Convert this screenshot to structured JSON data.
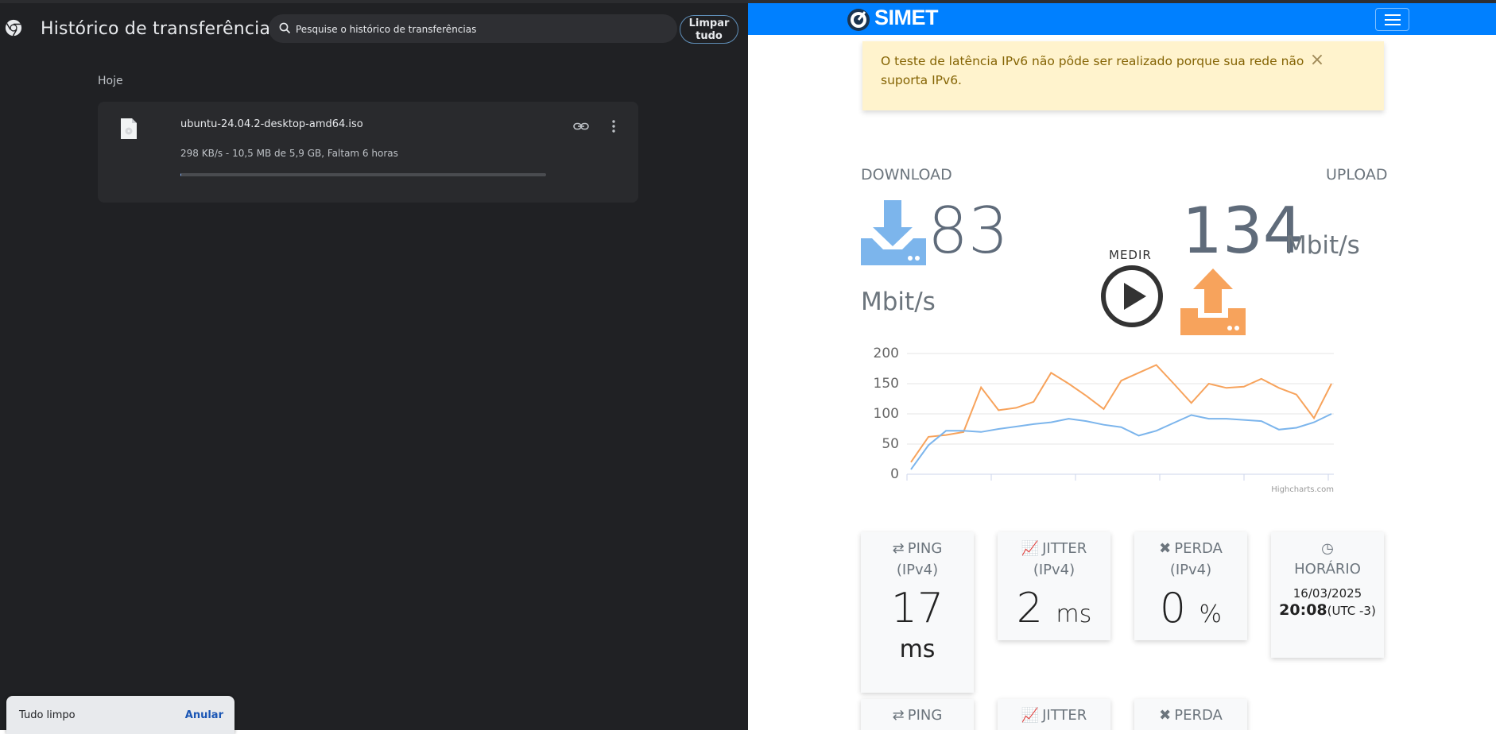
{
  "downloads": {
    "title": "Histórico de transferências",
    "search_placeholder": "Pesquise o histórico de transferências",
    "clear_all_label": "Limpar tudo",
    "section_label": "Hoje",
    "items": [
      {
        "filename": "ubuntu-24.04.2-desktop-amd64.iso",
        "status": "298 KB/s - 10,5 MB de 5,9 GB, Faltam 6 horas",
        "progress": 0.002
      }
    ],
    "toast": {
      "message": "Tudo limpo",
      "undo_label": "Anular"
    }
  },
  "simet": {
    "brand": "SIMET",
    "alert_text": "O teste de latência IPv6 não pôde ser realizado porque sua rede não suporta IPv6.",
    "alert_close": "×",
    "download_label": "DOWNLOAD",
    "upload_label": "UPLOAD",
    "download_value": "83",
    "download_unit": "Mbit/s",
    "upload_value": "134",
    "upload_unit": "Mbit/s",
    "measure_label": "MEDIR",
    "colors": {
      "brand_blue": "#0080ff",
      "download_blue": "#7cb5ec",
      "upload_orange": "#f7a35c"
    },
    "cards_row1": [
      {
        "title": "PING",
        "icon": "exchange-icon",
        "glyph": "⇄",
        "sub": "(IPv4)",
        "value": "17",
        "unit": "ms"
      },
      {
        "title": "JITTER",
        "icon": "chart-line-icon",
        "glyph": "📈",
        "sub": "(IPv4)",
        "value": "2",
        "unit": "ms"
      },
      {
        "title": "PERDA",
        "icon": "close-box-icon",
        "glyph": "✖",
        "sub": "(IPv4)",
        "value": "0",
        "unit": "%"
      },
      {
        "title": "HORÁRIO",
        "icon": "clock-icon",
        "glyph": "◷",
        "date": "16/03/2025",
        "time": "20:08",
        "tz": "(UTC -3)"
      }
    ],
    "cards_row2": [
      {
        "title": "PING",
        "icon": "exchange-icon"
      },
      {
        "title": "JITTER",
        "icon": "chart-line-icon"
      },
      {
        "title": "PERDA",
        "icon": "close-box-icon"
      }
    ]
  },
  "chart_data": {
    "type": "line",
    "credit": "Highcharts.com",
    "ylim": [
      0,
      200
    ],
    "yticks": [
      "200",
      "150",
      "100",
      "50",
      "0"
    ],
    "grid": true,
    "series": [
      {
        "color": "#f7a35c",
        "values": [
          20,
          62,
          65,
          70,
          144,
          106,
          110,
          120,
          168,
          150,
          130,
          108,
          155,
          168,
          181,
          150,
          118,
          150,
          143,
          145,
          158,
          143,
          132,
          93,
          150
        ]
      },
      {
        "color": "#7cb5ec",
        "values": [
          8,
          48,
          72,
          72,
          70,
          75,
          79,
          83,
          86,
          92,
          88,
          82,
          78,
          64,
          72,
          85,
          98,
          92,
          92,
          90,
          88,
          74,
          77,
          86,
          100
        ]
      }
    ]
  }
}
